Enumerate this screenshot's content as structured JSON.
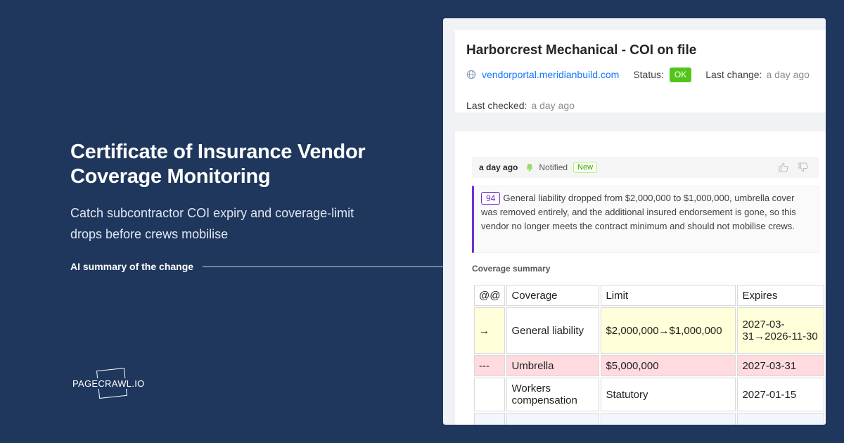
{
  "hero": {
    "title": "Certificate of Insurance Vendor Coverage Monitoring",
    "subtitle": "Catch subcontractor COI expiry and coverage-limit drops before crews mobilise",
    "callout": "AI summary of the change"
  },
  "brand": {
    "logo_text": "PAGECRAWL.IO"
  },
  "monitor": {
    "title": "Harborcrest Mechanical - COI on file",
    "url": "vendorportal.meridianbuild.com",
    "status_label": "Status:",
    "status_value": "OK",
    "last_change_label": "Last change:",
    "last_change_value": "a day ago",
    "last_checked_label": "Last checked:",
    "last_checked_value": "a day ago"
  },
  "history": {
    "time": "a day ago",
    "notified_label": "Notified",
    "new_tag": "New",
    "score": "94",
    "summary": "General liability dropped from $2,000,000 to $1,000,000, umbrella cover was removed entirely, and the additional insured endorsement is gone, so this vendor no longer meets the contract minimum and should not mobilise crews."
  },
  "coverage": {
    "label": "Coverage summary",
    "headers": [
      "@@",
      "Coverage",
      "Limit",
      "Expires"
    ],
    "rows": [
      {
        "marker": "→",
        "coverage": "General liability",
        "limit": "$2,000,000→$1,000,000",
        "expires": "2027-03-31→2026-11-30",
        "state": "changed"
      },
      {
        "marker": "---",
        "coverage": "Umbrella",
        "limit": "$5,000,000",
        "expires": "2027-03-31",
        "state": "removed"
      },
      {
        "marker": "",
        "coverage": "Workers compensation",
        "limit": "Statutory",
        "expires": "2027-01-15",
        "state": "unchanged"
      }
    ]
  },
  "colors": {
    "background": "#1f375d",
    "accent_purple": "#722ed1",
    "status_ok": "#52c41a",
    "link": "#1677ff",
    "changed_row": "#ffffd9",
    "removed_row": "#ffdbe0"
  },
  "icons": [
    "globe-icon",
    "bell-icon",
    "thumbs-up-icon",
    "thumbs-down-icon"
  ]
}
